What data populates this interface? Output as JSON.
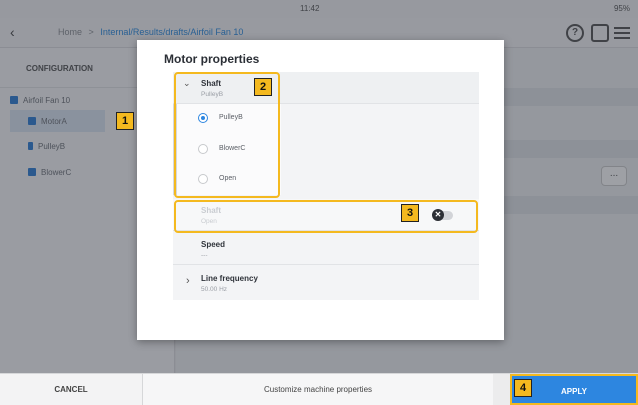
{
  "status": {
    "left": "",
    "time": "11:42",
    "battery": "95%"
  },
  "nav": {
    "back_glyph": "‹",
    "home": "Home",
    "path_a": "Internal/Results/drafts/Airfoil Fan 10",
    "help_glyph": "?"
  },
  "sidebar": {
    "title": "CONFIGURATION",
    "root": "Airfoil Fan 10",
    "items": [
      {
        "label": "MotorA"
      },
      {
        "label": "PulleyB"
      },
      {
        "label": "BlowerC"
      }
    ]
  },
  "markers": [
    "1",
    "2",
    "3",
    "4"
  ],
  "modal": {
    "title": "Motor properties",
    "shaft_section": {
      "label": "Shaft",
      "value": "PulleyB",
      "chevron": "⌄"
    },
    "options": [
      {
        "label": "PulleyB",
        "selected": true
      },
      {
        "label": "BlowerC",
        "selected": false
      },
      {
        "label": "Open",
        "selected": false
      }
    ],
    "shaft_disabled": {
      "label": "Shaft",
      "value": "Open",
      "toggle_glyph": "✕"
    },
    "speed": {
      "label": "Speed",
      "value": "---"
    },
    "line_frequency": {
      "label": "Line frequency",
      "value": "50.00 Hz",
      "chevron": "›"
    }
  },
  "background": {
    "more_label": "..."
  },
  "bottom": {
    "cancel": "CANCEL",
    "center": "Customize machine properties",
    "apply": "APPLY"
  },
  "colors": {
    "accent": "#2d86e0",
    "highlight": "#f4b91f"
  }
}
